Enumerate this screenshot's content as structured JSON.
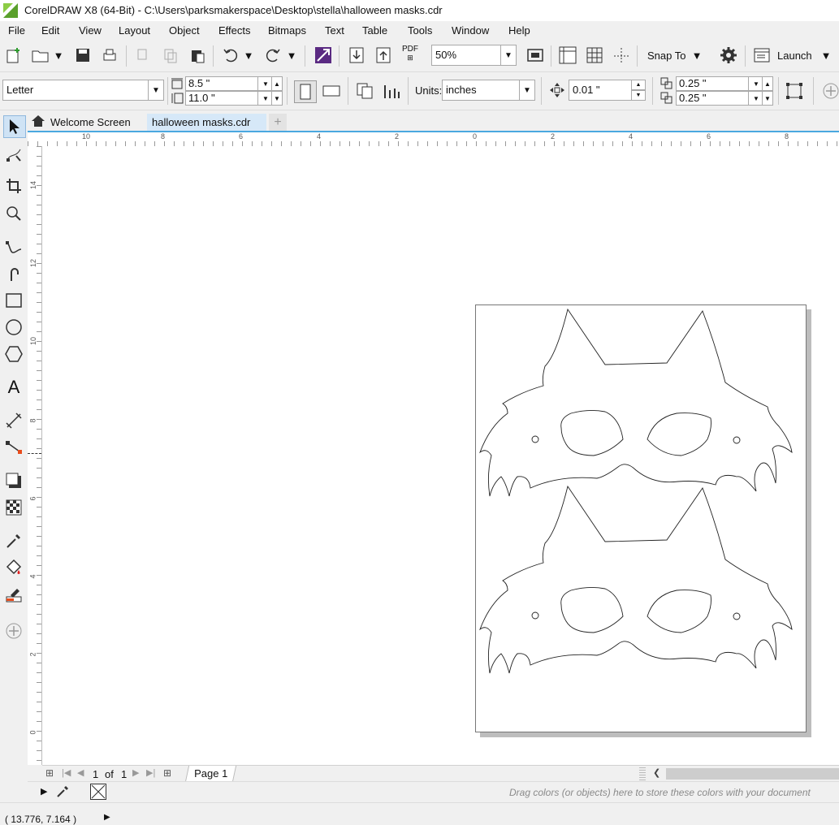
{
  "app": {
    "title": "CorelDRAW X8 (64-Bit) - C:\\Users\\parksmakerspace\\Desktop\\stella\\halloween masks.cdr",
    "logo_color": "#5aa02c"
  },
  "menu": [
    "File",
    "Edit",
    "View",
    "Layout",
    "Object",
    "Effects",
    "Bitmaps",
    "Text",
    "Table",
    "Tools",
    "Window",
    "Help"
  ],
  "toolbar": {
    "zoom": "50%",
    "snap_label": "Snap To",
    "launch_label": "Launch",
    "pdf_label": "PDF"
  },
  "property_bar": {
    "page_size": "Letter",
    "width": "8.5 \"",
    "height": "11.0 \"",
    "units_label": "Units:",
    "units_value": "inches",
    "nudge": "0.01 \"",
    "dup_x": "0.25 \"",
    "dup_y": "0.25 \""
  },
  "tabs": {
    "welcome": "Welcome Screen",
    "document": "halloween masks.cdr",
    "add": "+"
  },
  "ruler": {
    "h_labels": [
      "10",
      "8",
      "6",
      "4",
      "2",
      "0",
      "2",
      "4",
      "6",
      "8"
    ],
    "v_labels": [
      "14",
      "12",
      "10",
      "8",
      "6",
      "4",
      "2",
      "0"
    ]
  },
  "page_nav": {
    "current": "1",
    "of": "of",
    "total": "1",
    "page_tab": "Page 1"
  },
  "palette": {
    "hint": "Drag colors (or objects) here to store these colors with your document"
  },
  "status": {
    "coords": "( 13.776, 7.164 )"
  },
  "colors": {
    "accent": "#4aa8e0",
    "active_tab": "#d6e8f8",
    "purple_icon": "#5a2a82"
  }
}
